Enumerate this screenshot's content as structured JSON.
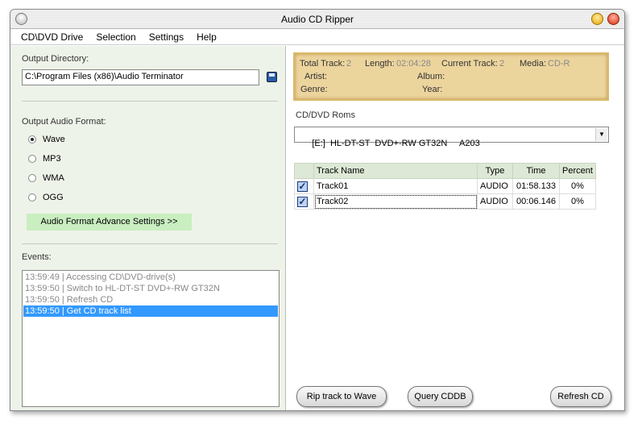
{
  "window": {
    "title": "Audio CD Ripper"
  },
  "menu": [
    "CD\\DVD Drive",
    "Selection",
    "Settings",
    "Help"
  ],
  "output": {
    "label": "Output Directory:",
    "path": "C:\\Program Files (x86)\\Audio Terminator"
  },
  "format": {
    "label": "Output Audio Format:",
    "options": [
      "Wave",
      "MP3",
      "WMA",
      "OGG"
    ],
    "selected": "Wave",
    "advance_button": "Audio Format Advance Settings >>"
  },
  "events": {
    "label": "Events:",
    "items": [
      "13:59:49 | Accessing CD\\DVD-drive(s)",
      "13:59:50 | Switch to HL-DT-ST DVD+-RW GT32N",
      "13:59:50 | Refresh CD",
      "13:59:50 | Get CD track list"
    ],
    "selected_index": 3
  },
  "info": {
    "total_track_label": "Total Track:",
    "total_track": "2",
    "length_label": "Length:",
    "length": "02:04:28",
    "current_track_label": "Current Track:",
    "current_track": "2",
    "media_label": "Media:",
    "media": "CD-R",
    "artist_label": "Artist:",
    "album_label": "Album:",
    "genre_label": "Genre:",
    "year_label": "Year:"
  },
  "drives": {
    "label": "CD/DVD Roms",
    "selected": "[E:]  HL-DT-ST  DVD+-RW GT32N     A203"
  },
  "tracks": {
    "headers": [
      "Track Name",
      "Type",
      "Time",
      "Percent"
    ],
    "rows": [
      {
        "checked": true,
        "name": "Track01",
        "type": "AUDIO",
        "time": "01:58.133",
        "percent": "0%"
      },
      {
        "checked": true,
        "name": "Track02",
        "type": "AUDIO",
        "time": "00:06.146",
        "percent": "0%"
      }
    ]
  },
  "buttons": {
    "rip": "Rip track to Wave",
    "query": "Query CDDB",
    "refresh": "Refresh CD"
  },
  "colors": {
    "selection": "#3399ff",
    "info_panel": "#ecd49d",
    "left_panel": "#eef3e9"
  }
}
